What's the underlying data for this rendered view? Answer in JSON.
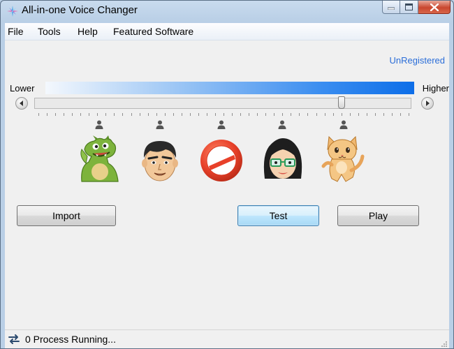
{
  "window": {
    "title": "All-in-one Voice Changer",
    "icon": "voice-waveform-icon",
    "controls": [
      "minimize-icon",
      "maximize-icon",
      "close-icon"
    ]
  },
  "menubar": {
    "items": [
      {
        "label": "File"
      },
      {
        "label": "Tools"
      },
      {
        "label": "Help"
      },
      {
        "label": "Featured Software"
      }
    ]
  },
  "registration": {
    "label": "UnRegistered"
  },
  "pitch": {
    "lower_label": "Lower",
    "higher_label": "Higher",
    "value_fraction": 0.82,
    "gradient_colors": [
      "#f4f8fd",
      "#0d6ee8"
    ]
  },
  "voices": [
    {
      "name": "dragon-voice",
      "icon": "dragon-icon"
    },
    {
      "name": "man-voice",
      "icon": "man-face-icon"
    },
    {
      "name": "no-effect",
      "icon": "no-entry-icon"
    },
    {
      "name": "woman-voice",
      "icon": "woman-face-icon"
    },
    {
      "name": "cat-voice",
      "icon": "cat-icon"
    }
  ],
  "buttons": {
    "import": "Import",
    "test": "Test",
    "play": "Play"
  },
  "status": {
    "icon": "swap-arrows-icon",
    "text": "0 Process Running..."
  },
  "colors": {
    "link": "#2a6dd8",
    "accent": "#0d6ee8",
    "close_button": "#c9472f"
  }
}
